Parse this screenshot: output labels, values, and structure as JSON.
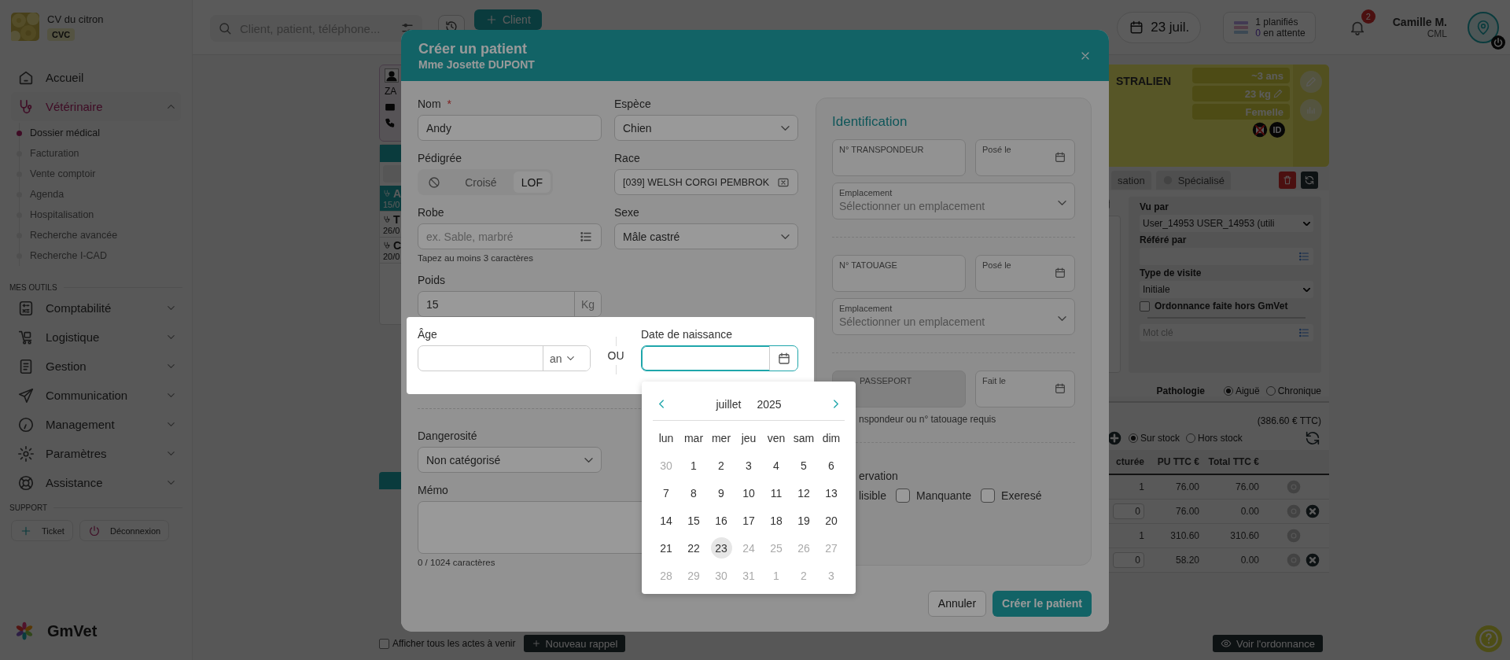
{
  "sidebar": {
    "clinic": {
      "name": "CV du citron",
      "code": "CVC"
    },
    "nav": [
      {
        "label": "Accueil",
        "active": false,
        "expanded": false
      },
      {
        "label": "Vétérinaire",
        "active": true,
        "expanded": true,
        "children": [
          {
            "label": "Dossier médical",
            "selected": true
          },
          {
            "label": "Facturation",
            "selected": false
          },
          {
            "label": "Vente comptoir",
            "selected": false
          },
          {
            "label": "Agenda",
            "selected": false
          },
          {
            "label": "Hospitalisation",
            "selected": false
          },
          {
            "label": "Recherche avancée",
            "selected": false
          },
          {
            "label": "Recherche I-CAD",
            "selected": false
          }
        ]
      }
    ],
    "tools_heading": "MES OUTILS",
    "tools": [
      {
        "label": "Comptabilité",
        "expanded": false
      },
      {
        "label": "Logistique",
        "expanded": false
      },
      {
        "label": "Gestion",
        "expanded": false
      },
      {
        "label": "Communication",
        "expanded": false
      },
      {
        "label": "Management",
        "expanded": false
      },
      {
        "label": "Paramètres",
        "expanded": false
      },
      {
        "label": "Assistance",
        "expanded": false
      }
    ],
    "support_heading": "SUPPORT",
    "support_buttons": [
      {
        "label": "Ticket"
      },
      {
        "label": "Déconnexion"
      }
    ],
    "brand": "GmVet"
  },
  "topbar": {
    "search_placeholder": "Client, patient, téléphone...",
    "new_button": "Client",
    "date": "23 juil.",
    "planned_count": "1",
    "planned_label": "planifiés",
    "waiting_count": "0",
    "waiting_label": "en attente",
    "notifications": "2",
    "user_name": "Camille M.",
    "user_code": "CML"
  },
  "background": {
    "owner_initials": "ZA",
    "breed_fragment": "STRALIEN",
    "tags": [
      "~3 ans",
      "23 kg",
      "Femelle"
    ],
    "id_badge": "ID",
    "visits": [
      {
        "initial": "A",
        "date": "15/0",
        "selected": true
      },
      {
        "initial": "T",
        "date": "26/0",
        "selected": false
      },
      {
        "initial": "C",
        "date": "20/0",
        "selected": false
      }
    ],
    "tabs": [
      {
        "label": "sation",
        "selected": false
      },
      {
        "label": "Spécialisé",
        "selected": false
      }
    ],
    "seen_by_label": "Vu par",
    "seen_by": "User_14953 USER_14953 (utili",
    "referred_label": "Référé par",
    "visit_type_label": "Type de visite",
    "visit_type": "Initiale",
    "external_prescription": {
      "label": "Ordonnance faite hors GmVet",
      "checked": false
    },
    "keyword_placeholder": "Mot clé",
    "pathology": {
      "label": "Pathologie",
      "options": [
        {
          "label": "Aiguë",
          "selected": true
        },
        {
          "label": "Chronique",
          "selected": false
        }
      ]
    },
    "total": "(386.60 € TTC)",
    "stock": [
      {
        "label": "Sur stock",
        "selected": true
      },
      {
        "label": "Hors stock",
        "selected": false
      }
    ],
    "table": {
      "columns": [
        "cturée",
        "PU TTC €",
        "Total TTC €"
      ],
      "rows": [
        {
          "cells": [
            "1",
            "76.00",
            "76.00"
          ],
          "editable": false
        },
        {
          "cells": [
            "0",
            "76.00",
            "0.00"
          ],
          "editable": true
        },
        {
          "cells": [
            "1",
            "310.60",
            "310.60"
          ],
          "editable": false
        },
        {
          "cells": [
            "0",
            "58.20",
            "0.00"
          ],
          "editable": true
        }
      ]
    },
    "show_all": {
      "label": "Afficher tous les actes à venir",
      "checked": false
    },
    "reminder_button": "Nouveau rappel",
    "prescription_button": "Voir l'ordonnance"
  },
  "modal": {
    "title": "Créer un patient",
    "subtitle": "Mme Josette DUPONT",
    "name": {
      "label": "Nom",
      "required_mark": "*",
      "value": "Andy"
    },
    "species": {
      "label": "Espèce",
      "value": "Chien"
    },
    "pedigree": {
      "label": "Pédigrée",
      "options": [
        {
          "kind": "none",
          "selected": false
        },
        {
          "kind": "text",
          "label": "Croisé",
          "selected": false
        },
        {
          "kind": "text",
          "label": "LOF",
          "selected": true
        }
      ]
    },
    "breed": {
      "label": "Race",
      "value": "[039] WELSH CORGI PEMBROK"
    },
    "coat": {
      "label": "Robe",
      "placeholder": "ex. Sable, marbré",
      "hint": "Tapez au moins 3 caractères"
    },
    "sex": {
      "label": "Sexe",
      "value": "Mâle castré"
    },
    "weight": {
      "label": "Poids",
      "value": "15",
      "unit": "Kg"
    },
    "age": {
      "label": "Âge",
      "unit": "an"
    },
    "or": "OU",
    "birth_date": {
      "label": "Date de naissance",
      "focused": true
    },
    "danger": {
      "label": "Dangerosité",
      "value": "Non catégorisé"
    },
    "memo": {
      "label": "Mémo",
      "counter": "0 / 1024 caractères"
    },
    "identification": {
      "title": "Identification",
      "transponder": "N° TRANSPONDEUR",
      "transponder_date": "Posé le",
      "transponder_location": {
        "label": "Emplacement",
        "placeholder": "Sélectionner un emplacement"
      },
      "tattoo": "N° TATOUAGE",
      "tattoo_date": "Posé le",
      "tattoo_location": {
        "label": "Emplacement",
        "placeholder": "Sélectionner un emplacement"
      },
      "passport": {
        "label": "PASSEPORT",
        "disabled": true
      },
      "passport_date": "Fait le",
      "passport_hint": "nspondeur ou n° tatouage requis",
      "observation_label": "ervation",
      "observation_fragment": "lisible",
      "observations": [
        {
          "label": "Manquante",
          "checked": false
        },
        {
          "label": "Exeresé",
          "checked": false
        }
      ]
    },
    "cancel": "Annuler",
    "submit": "Créer le patient"
  },
  "calendar": {
    "month": "juillet",
    "year": "2025",
    "weekdays": [
      "lun",
      "mar",
      "mer",
      "jeu",
      "ven",
      "sam",
      "dim"
    ],
    "weeks": [
      [
        {
          "label": "30",
          "disabled": true,
          "today": false
        },
        {
          "label": "1",
          "disabled": false,
          "today": false
        },
        {
          "label": "2",
          "disabled": false,
          "today": false
        },
        {
          "label": "3",
          "disabled": false,
          "today": false
        },
        {
          "label": "4",
          "disabled": false,
          "today": false
        },
        {
          "label": "5",
          "disabled": false,
          "today": false
        },
        {
          "label": "6",
          "disabled": false,
          "today": false
        }
      ],
      [
        {
          "label": "7",
          "disabled": false,
          "today": false
        },
        {
          "label": "8",
          "disabled": false,
          "today": false
        },
        {
          "label": "9",
          "disabled": false,
          "today": false
        },
        {
          "label": "10",
          "disabled": false,
          "today": false
        },
        {
          "label": "11",
          "disabled": false,
          "today": false
        },
        {
          "label": "12",
          "disabled": false,
          "today": false
        },
        {
          "label": "13",
          "disabled": false,
          "today": false
        }
      ],
      [
        {
          "label": "14",
          "disabled": false,
          "today": false
        },
        {
          "label": "15",
          "disabled": false,
          "today": false
        },
        {
          "label": "16",
          "disabled": false,
          "today": false
        },
        {
          "label": "17",
          "disabled": false,
          "today": false
        },
        {
          "label": "18",
          "disabled": false,
          "today": false
        },
        {
          "label": "19",
          "disabled": false,
          "today": false
        },
        {
          "label": "20",
          "disabled": false,
          "today": false
        }
      ],
      [
        {
          "label": "21",
          "disabled": false,
          "today": false
        },
        {
          "label": "22",
          "disabled": false,
          "today": false
        },
        {
          "label": "23",
          "disabled": false,
          "today": true
        },
        {
          "label": "24",
          "disabled": true,
          "today": false
        },
        {
          "label": "25",
          "disabled": true,
          "today": false
        },
        {
          "label": "26",
          "disabled": true,
          "today": false
        },
        {
          "label": "27",
          "disabled": true,
          "today": false
        }
      ],
      [
        {
          "label": "28",
          "disabled": true,
          "today": false
        },
        {
          "label": "29",
          "disabled": true,
          "today": false
        },
        {
          "label": "30",
          "disabled": true,
          "today": false
        },
        {
          "label": "31",
          "disabled": true,
          "today": false
        },
        {
          "label": "1",
          "disabled": true,
          "today": false
        },
        {
          "label": "2",
          "disabled": true,
          "today": false
        },
        {
          "label": "3",
          "disabled": true,
          "today": false
        }
      ]
    ]
  }
}
